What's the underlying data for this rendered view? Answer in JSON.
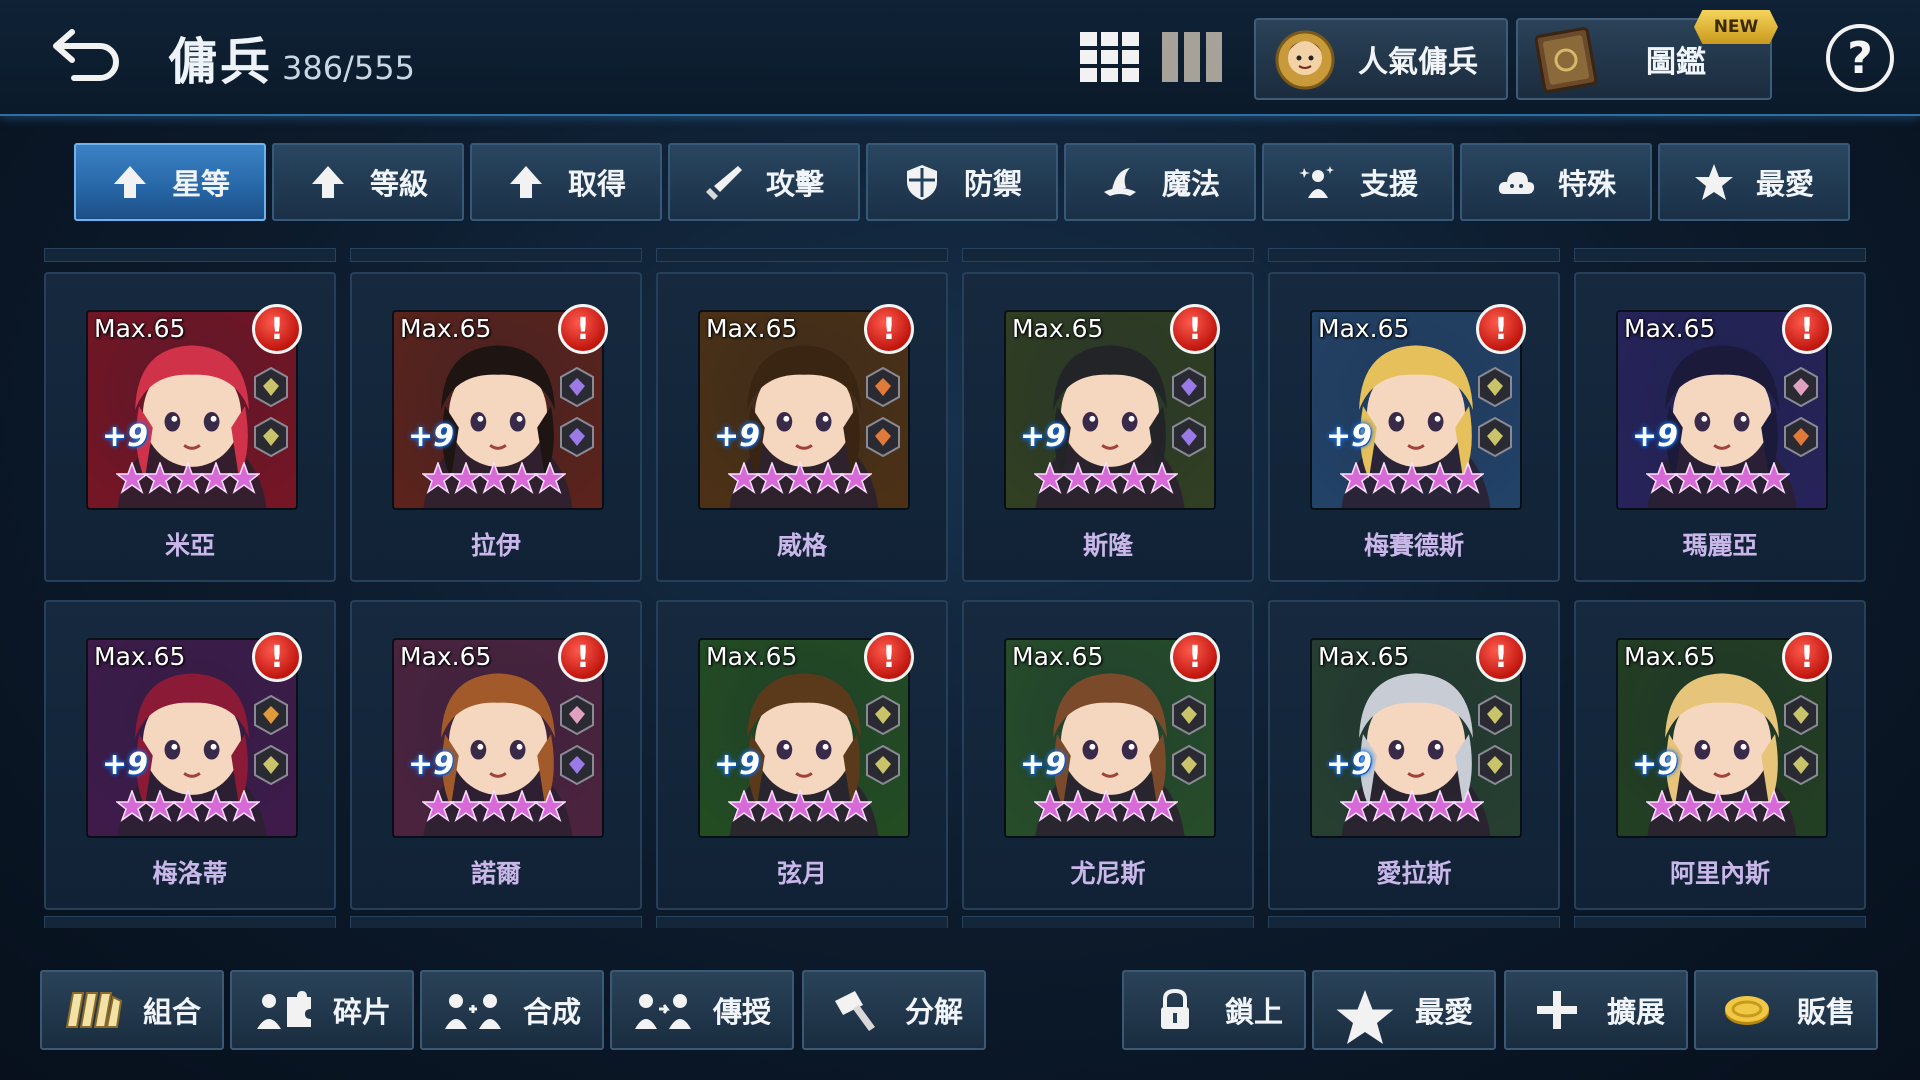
{
  "header": {
    "title": "傭兵",
    "count": "386/555",
    "popular_label": "人氣傭兵",
    "codex_label": "圖鑑",
    "new_badge": "NEW",
    "help_label": "?"
  },
  "tabs": [
    {
      "label": "星等",
      "icon": "arrow-up-icon",
      "active": true
    },
    {
      "label": "等級",
      "icon": "arrow-up-icon"
    },
    {
      "label": "取得",
      "icon": "arrow-up-icon"
    },
    {
      "label": "攻擊",
      "icon": "sword-icon"
    },
    {
      "label": "防禦",
      "icon": "shield-icon"
    },
    {
      "label": "魔法",
      "icon": "magic-hat-icon"
    },
    {
      "label": "支援",
      "icon": "support-icon"
    },
    {
      "label": "特殊",
      "icon": "cloud-icon"
    },
    {
      "label": "最愛",
      "icon": "star-icon"
    }
  ],
  "heroes": [
    {
      "name": "米亞",
      "level": "Max.65",
      "plus": "+9",
      "stars": 5,
      "bg": "#8a1a2c",
      "hair": "#d0324a",
      "runes": [
        "#c9c46a",
        "#c9c46a"
      ]
    },
    {
      "name": "拉伊",
      "level": "Max.65",
      "plus": "+9",
      "stars": 5,
      "bg": "#6b2a22",
      "hair": "#1e1412",
      "runes": [
        "#9a7ae6",
        "#9a7ae6"
      ]
    },
    {
      "name": "威格",
      "level": "Max.65",
      "plus": "+9",
      "stars": 5,
      "bg": "#5a3a1a",
      "hair": "#3a2412",
      "runes": [
        "#e07a3a",
        "#e07a3a"
      ]
    },
    {
      "name": "斯隆",
      "level": "Max.65",
      "plus": "+9",
      "stars": 5,
      "bg": "#3a4a2a",
      "hair": "#222428",
      "runes": [
        "#9a7ae6",
        "#9a7ae6"
      ]
    },
    {
      "name": "梅賽德斯",
      "level": "Max.65",
      "plus": "+9",
      "stars": 5,
      "bg": "#2a4e7a",
      "hair": "#e6c05a",
      "runes": [
        "#c9c46a",
        "#c9c46a"
      ]
    },
    {
      "name": "瑪麗亞",
      "level": "Max.65",
      "plus": "+9",
      "stars": 5,
      "bg": "#2e2a6a",
      "hair": "#1c1a3a",
      "runes": [
        "#e0a0c0",
        "#e07a3a"
      ]
    },
    {
      "name": "梅洛蒂",
      "level": "Max.65",
      "plus": "+9",
      "stars": 5,
      "bg": "#4a2058",
      "hair": "#8a1a36",
      "runes": [
        "#e09a3a",
        "#c9c46a"
      ]
    },
    {
      "name": "諾爾",
      "level": "Max.65",
      "plus": "+9",
      "stars": 5,
      "bg": "#5a2a4a",
      "hair": "#a25a2a",
      "runes": [
        "#e0a0c0",
        "#9a7ae6"
      ]
    },
    {
      "name": "弦月",
      "level": "Max.65",
      "plus": "+9",
      "stars": 5,
      "bg": "#2a5a2a",
      "hair": "#5a3a1a",
      "runes": [
        "#c9c46a",
        "#c9c46a"
      ]
    },
    {
      "name": "尤尼斯",
      "level": "Max.65",
      "plus": "+9",
      "stars": 5,
      "bg": "#2e5a32",
      "hair": "#7a4a2a",
      "runes": [
        "#c9c46a",
        "#c9c46a"
      ]
    },
    {
      "name": "愛拉斯",
      "level": "Max.65",
      "plus": "+9",
      "stars": 5,
      "bg": "#2e4a3a",
      "hair": "#c8ccd4",
      "runes": [
        "#c9c46a",
        "#c9c46a"
      ]
    },
    {
      "name": "阿里內斯",
      "level": "Max.65",
      "plus": "+9",
      "stars": 5,
      "bg": "#2a4a2a",
      "hair": "#e6c47a",
      "runes": [
        "#c9c46a",
        "#c9c46a"
      ]
    }
  ],
  "bottom_left": [
    {
      "label": "組合",
      "icon": "team-icon"
    },
    {
      "label": "碎片",
      "icon": "puzzle-icon"
    },
    {
      "label": "合成",
      "icon": "merge-icon"
    },
    {
      "label": "傳授",
      "icon": "transfer-icon"
    },
    {
      "label": "分解",
      "icon": "hammer-icon"
    }
  ],
  "bottom_right": [
    {
      "label": "鎖上",
      "icon": "lock-icon"
    },
    {
      "label": "最愛",
      "icon": "star-icon"
    },
    {
      "label": "擴展",
      "icon": "plus-icon"
    },
    {
      "label": "販售",
      "icon": "coin-icon"
    }
  ],
  "colors": {
    "accent": "#3b82c4",
    "name_text": "#c9b7ea",
    "alert": "#c0160e",
    "star": "#d86ad8"
  }
}
